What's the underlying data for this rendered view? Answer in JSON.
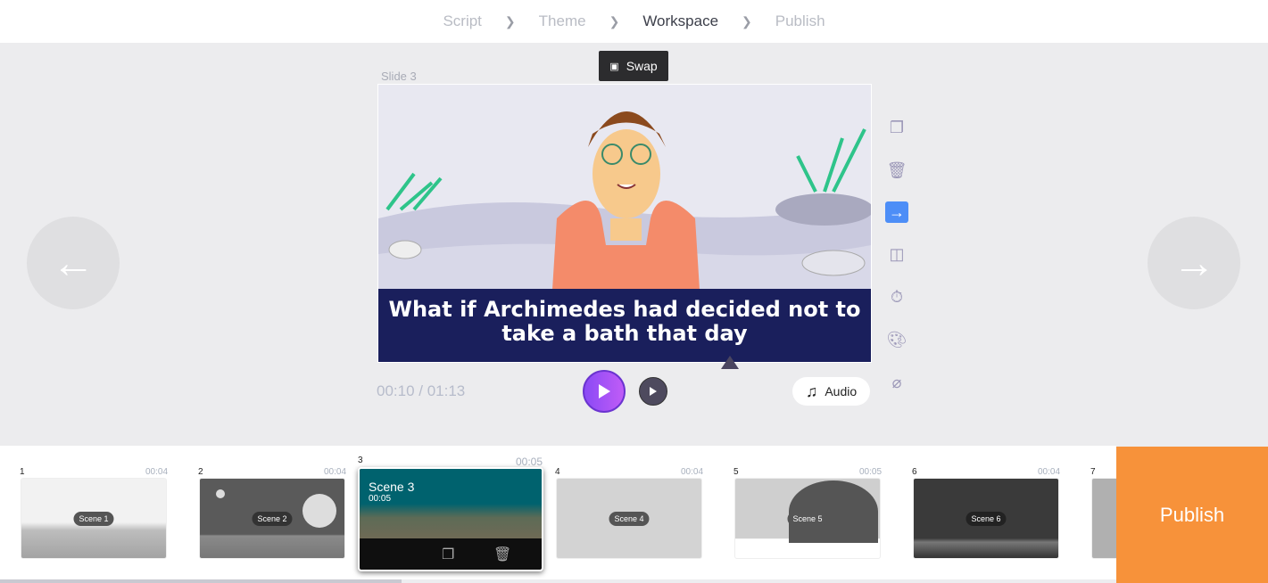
{
  "nav": {
    "steps": [
      "Script",
      "Theme",
      "Workspace",
      "Publish"
    ],
    "active": "Workspace"
  },
  "slide": {
    "label": "Slide 3",
    "caption": "What if Archimedes had decided not to take a bath that day",
    "swap_label": "Swap"
  },
  "player": {
    "time": "00:10 / 01:13",
    "audio_label": "Audio"
  },
  "tools": [
    "copy-icon",
    "trash-icon",
    "transition-arrow-icon",
    "layout-icon",
    "timer-icon",
    "palette-icon",
    "hide-eye-icon"
  ],
  "scenes": [
    {
      "num": "1",
      "name": "Scene 1",
      "duration": "00:04"
    },
    {
      "num": "2",
      "name": "Scene 2",
      "duration": "00:04"
    },
    {
      "num": "3",
      "name": "Scene 3",
      "duration": "00:05"
    },
    {
      "num": "4",
      "name": "Scene 4",
      "duration": "00:04"
    },
    {
      "num": "5",
      "name": "Scene 5",
      "duration": "00:05"
    },
    {
      "num": "6",
      "name": "Scene 6",
      "duration": "00:04"
    },
    {
      "num": "7"
    }
  ],
  "publish_label": "Publish",
  "colors": {
    "accent": "#f7923a",
    "play": "#9b51f7",
    "active_tool": "#4d8ef7",
    "caption_bg": "#1a1f5c"
  }
}
